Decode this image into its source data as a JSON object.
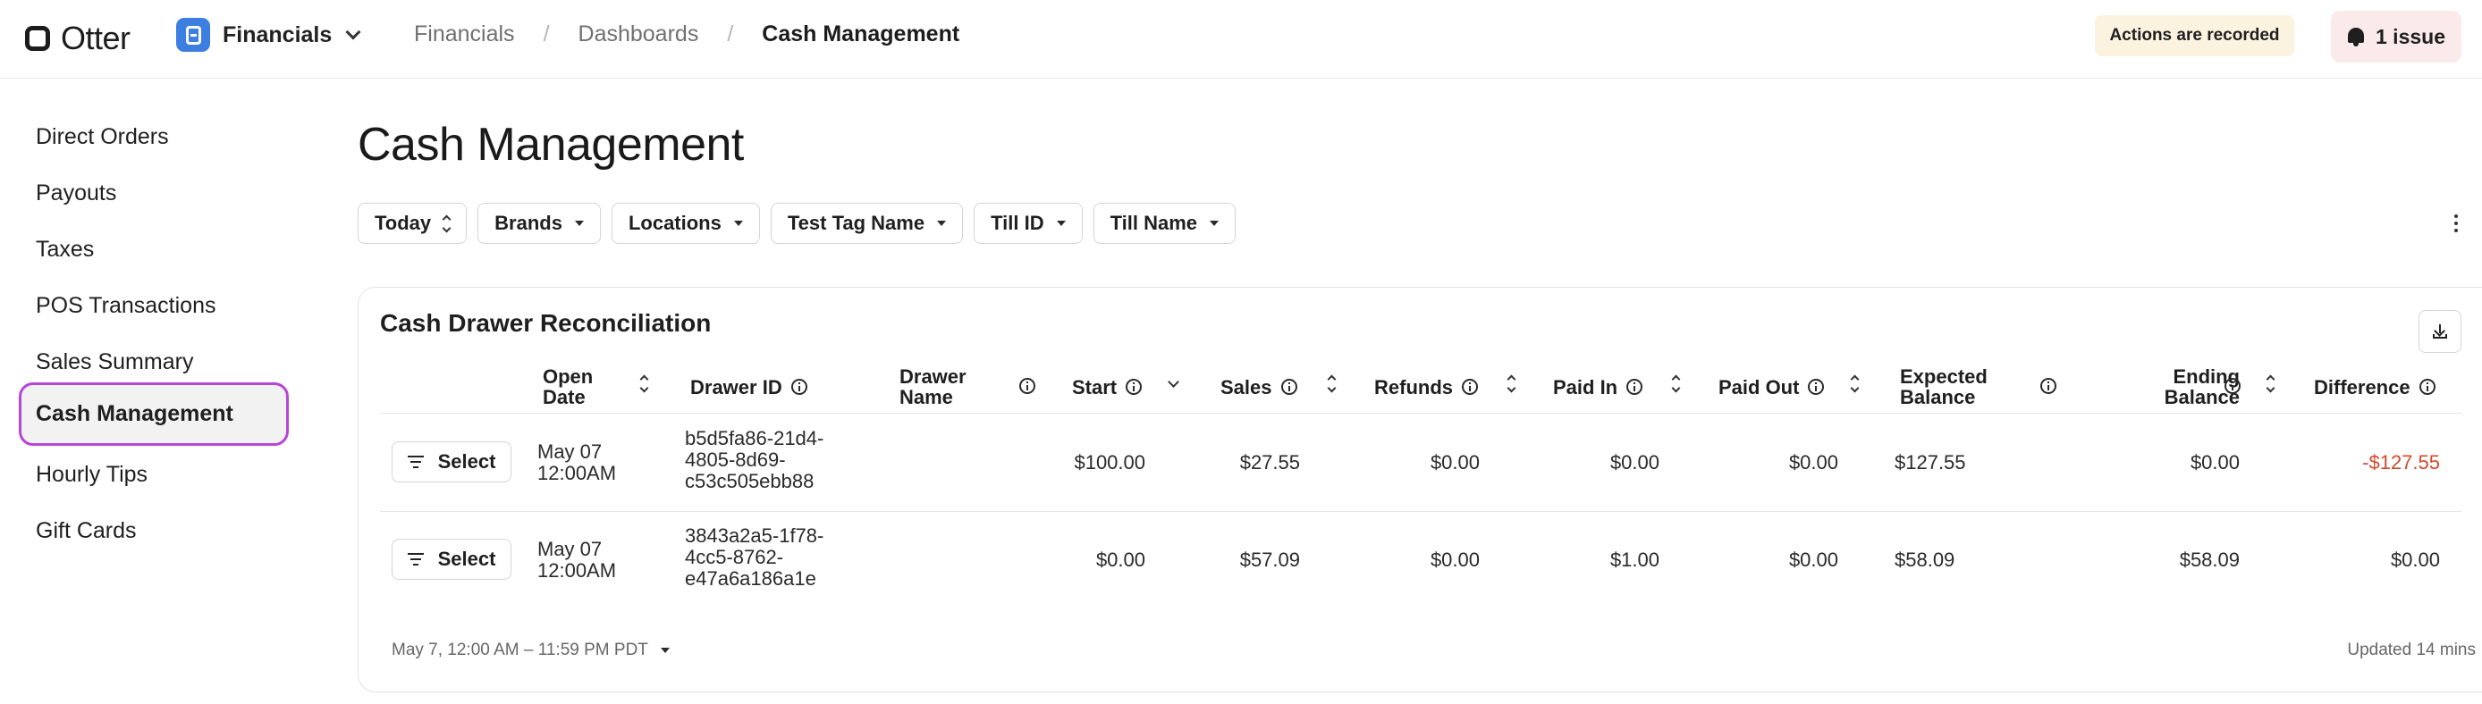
{
  "app": {
    "logo": "Otter",
    "current_app": "Financials"
  },
  "breadcrumb": [
    "Financials",
    "Dashboards",
    "Cash Management"
  ],
  "header": {
    "recorded_label": "Actions are recorded",
    "issues_label": "1 issue"
  },
  "sidebar": {
    "items": [
      {
        "label": "Direct Orders",
        "active": false
      },
      {
        "label": "Payouts",
        "active": false
      },
      {
        "label": "Taxes",
        "active": false
      },
      {
        "label": "POS Transactions",
        "active": false
      },
      {
        "label": "Sales Summary",
        "active": false
      },
      {
        "label": "Cash Management",
        "active": true
      },
      {
        "label": "Hourly Tips",
        "active": false
      },
      {
        "label": "Gift Cards",
        "active": false
      }
    ]
  },
  "page": {
    "title": "Cash Management"
  },
  "filters": [
    "Today",
    "Brands",
    "Locations",
    "Test Tag Name",
    "Till ID",
    "Till Name"
  ],
  "card": {
    "title": "Cash Drawer Reconciliation",
    "columns": [
      {
        "label": "Open Date"
      },
      {
        "label": "Drawer ID"
      },
      {
        "label": "Drawer Name"
      },
      {
        "label": "Start"
      },
      {
        "label": "Sales"
      },
      {
        "label": "Refunds"
      },
      {
        "label": "Paid In"
      },
      {
        "label": "Paid Out"
      },
      {
        "label": "Expected Balance"
      },
      {
        "label": "Ending Balance"
      },
      {
        "label": "Difference"
      }
    ],
    "select_label": "Select",
    "rows": [
      {
        "open_date": "May 07 12:00AM",
        "drawer_id": "b5d5fa86-21d4-4805-8d69-c53c505ebb88",
        "drawer_name": "",
        "start": "$100.00",
        "sales": "$27.55",
        "refunds": "$0.00",
        "paid_in": "$0.00",
        "paid_out": "$0.00",
        "expected_balance": "$127.55",
        "ending_balance": "$0.00",
        "difference": "-$127.55"
      },
      {
        "open_date": "May 07 12:00AM",
        "drawer_id": "3843a2a5-1f78-4cc5-8762-e47a6a186a1e",
        "drawer_name": "",
        "start": "$0.00",
        "sales": "$57.09",
        "refunds": "$0.00",
        "paid_in": "$1.00",
        "paid_out": "$0.00",
        "expected_balance": "$58.09",
        "ending_balance": "$58.09",
        "difference": "$0.00"
      }
    ],
    "date_range": "May 7, 12:00 AM – 11:59 PM PDT",
    "updated": "Updated 14 mins"
  },
  "colors": {
    "active_outline": "#b546d8",
    "negative": "#d04a2c",
    "app_icon": "#3d7fe0",
    "recorded_bg": "#fbf3e0",
    "issues_bg": "#fbeaea"
  }
}
